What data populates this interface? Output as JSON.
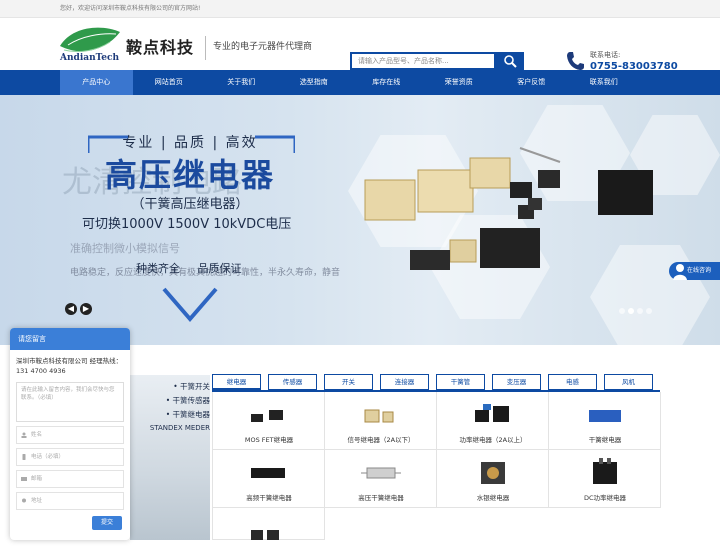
{
  "topbar": {
    "welcome": "您好，欢迎访问深圳市鞍点科技有限公司的官方网站!"
  },
  "header": {
    "logo_text": "AndianTech",
    "brand": "鞍点科技",
    "slogan": "专业的电子元器件代理商",
    "search_placeholder": "请输入产品型号、产品名称...",
    "phone_label": "联系电话:",
    "phone_number": "0755-83003780"
  },
  "nav": {
    "items": [
      {
        "label": "产品中心",
        "active": true
      },
      {
        "label": "网站首页"
      },
      {
        "label": "关于我们"
      },
      {
        "label": "选型指南"
      },
      {
        "label": "库存在线"
      },
      {
        "label": "荣誉资质"
      },
      {
        "label": "客户反馈"
      },
      {
        "label": "联系我们"
      }
    ]
  },
  "banner": {
    "line1": "专业 | 品质 | 高效",
    "title": "高压继电器",
    "subtitle": "（干簧高压继电器）",
    "spec": "可切换1000V 1500V 10kVDC电压",
    "ghost1": "尤清控制电路",
    "ghost2": "准确控制微小模拟信号",
    "ghost3": "电路稳定，反应速度快，具有极其优越的可靠性，半永久寿命，静音",
    "tag_left": "种类齐全",
    "tag_right": "品质保证"
  },
  "online": {
    "label": "在线咨询"
  },
  "chat": {
    "header": "请您留言",
    "company_info": "深圳市鞍点科技有限公司 经理热线：131 4700 4936",
    "textarea_placeholder": "请在此输入留言内容，我们会尽快与您联系。（必填）",
    "fields": [
      "姓名",
      "电话（必填）",
      "邮箱",
      "地址"
    ],
    "submit": "提交"
  },
  "side": {
    "items": [
      "• 干簧开关",
      "• 干簧传感器",
      "• 干簧继电器"
    ],
    "brand": "STANDEX MEDER"
  },
  "tabs": [
    {
      "label": "继电器",
      "active": true
    },
    {
      "label": "传感器"
    },
    {
      "label": "开关"
    },
    {
      "label": "连接器"
    },
    {
      "label": "干簧管"
    },
    {
      "label": "变压器"
    },
    {
      "label": "电感"
    },
    {
      "label": "风机"
    }
  ],
  "products": [
    {
      "name": "MOS FET继电器"
    },
    {
      "name": "信号继电器（2A以下）"
    },
    {
      "name": "功率继电器（2A以上）"
    },
    {
      "name": "干簧继电器"
    },
    {
      "name": "高频干簧继电器"
    },
    {
      "name": "高压干簧继电器"
    },
    {
      "name": "水银继电器"
    },
    {
      "name": "DC功率继电器"
    }
  ],
  "colors": {
    "primary": "#0d4aa2",
    "nav_active": "#3a76cf",
    "chat": "#3b7fd8"
  }
}
